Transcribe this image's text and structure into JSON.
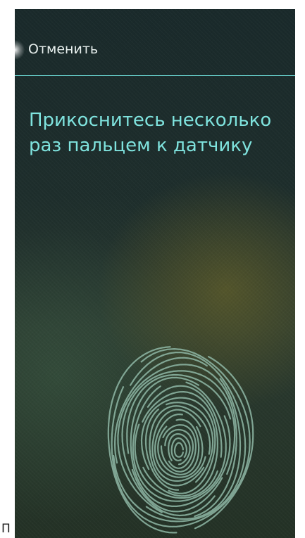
{
  "header": {
    "cancel_label": "Отменить"
  },
  "main": {
    "instruction": "Прикоснитесь несколько раз пальцем к датчику"
  },
  "fingerprint": {
    "icon": "fingerprint-icon"
  },
  "overflow_text": "П",
  "colors": {
    "accent": "#7fe3de",
    "divider": "#6ad6d2",
    "fingerprint": "#8fb8a6",
    "text": "#e8f0ee"
  }
}
